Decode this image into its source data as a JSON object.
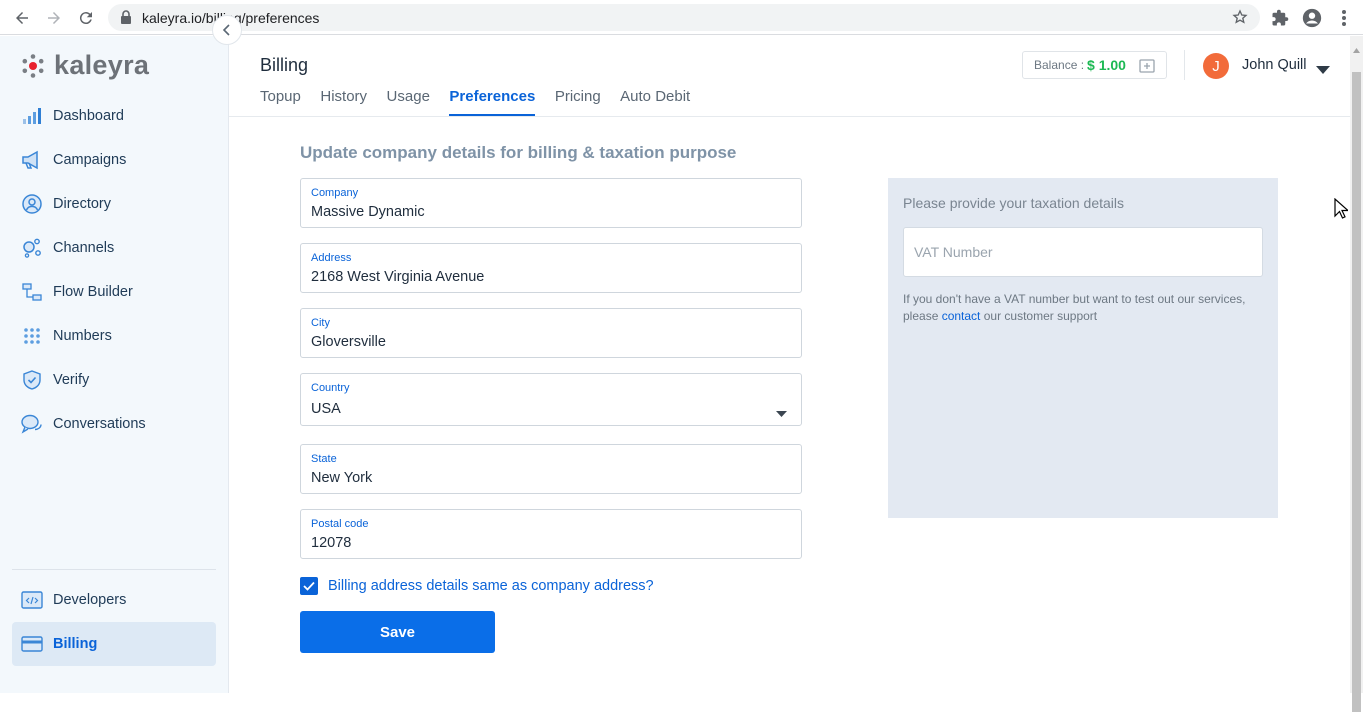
{
  "browser": {
    "url": "kaleyra.io/billing/preferences",
    "icons": [
      "back-icon",
      "forward-icon",
      "reload-icon",
      "lock-icon",
      "star-icon",
      "extensions-icon",
      "profile-icon",
      "menu-icon"
    ]
  },
  "sidebar": {
    "logo_text": "kaleyra",
    "items": [
      {
        "label": "Dashboard",
        "icon": "bar-chart-icon"
      },
      {
        "label": "Campaigns",
        "icon": "megaphone-icon"
      },
      {
        "label": "Directory",
        "icon": "contact-icon"
      },
      {
        "label": "Channels",
        "icon": "channels-icon"
      },
      {
        "label": "Flow Builder",
        "icon": "flow-icon"
      },
      {
        "label": "Numbers",
        "icon": "dialpad-icon"
      },
      {
        "label": "Verify",
        "icon": "shield-check-icon"
      },
      {
        "label": "Conversations",
        "icon": "chat-bubbles-icon"
      }
    ],
    "bottom_items": [
      {
        "label": "Developers",
        "icon": "code-icon"
      },
      {
        "label": "Billing",
        "icon": "credit-card-icon",
        "active": true
      }
    ]
  },
  "header": {
    "title": "Billing",
    "tabs": [
      {
        "label": "Topup"
      },
      {
        "label": "History"
      },
      {
        "label": "Usage"
      },
      {
        "label": "Preferences",
        "active": true
      },
      {
        "label": "Pricing"
      },
      {
        "label": "Auto Debit"
      }
    ],
    "balance_label": "Balance :",
    "balance_value": "$ 1.00",
    "user_initial": "J",
    "user_name": "John Quill"
  },
  "form": {
    "section_title": "Update company details for billing & taxation purpose",
    "company": {
      "label": "Company",
      "value": "Massive Dynamic"
    },
    "address": {
      "label": "Address",
      "value": "2168  West Virginia Avenue"
    },
    "city": {
      "label": "City",
      "value": "Gloversville"
    },
    "country": {
      "label": "Country",
      "value": "USA"
    },
    "state": {
      "label": "State",
      "value": "New York"
    },
    "postal_code": {
      "label": "Postal code",
      "value": "12078"
    },
    "billing_same_label": "Billing address details same as company address?",
    "billing_same_checked": true,
    "save_label": "Save"
  },
  "tax": {
    "title": "Please provide your taxation details",
    "vat_placeholder": "VAT Number",
    "note_pre": "If you don't have a VAT number but want to test out our services, please ",
    "note_link": "contact",
    "note_post": " our customer support"
  },
  "colors": {
    "accent": "#0a63d8",
    "balance": "#1db954",
    "avatar": "#f26b3a",
    "sidebar_bg": "#f3f8fc",
    "tax_panel_bg": "#e3e9f2"
  }
}
